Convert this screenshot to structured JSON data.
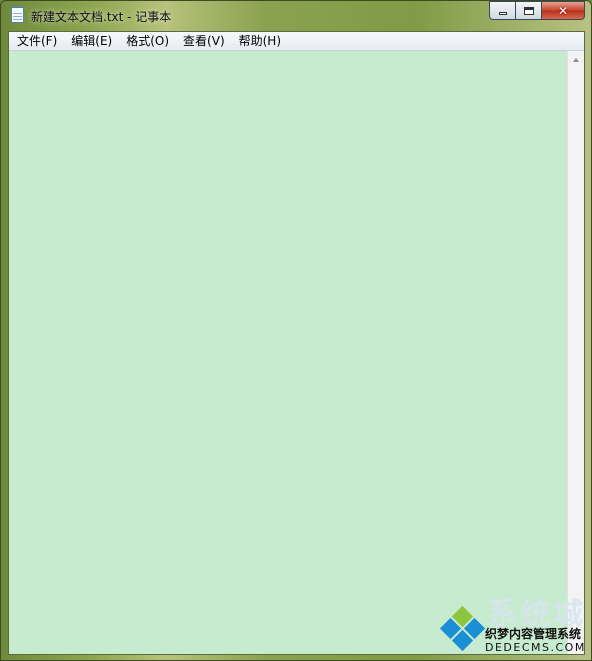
{
  "window": {
    "title": "新建文本文档.txt - 记事本",
    "icon": "notepad-icon",
    "controls": {
      "minimize": "minimize-icon",
      "maximize": "maximize-icon",
      "close": "close-icon"
    }
  },
  "menu": {
    "items": [
      {
        "label": "文件(F)"
      },
      {
        "label": "编辑(E)"
      },
      {
        "label": "格式(O)"
      },
      {
        "label": "查看(V)"
      },
      {
        "label": "帮助(H)"
      }
    ]
  },
  "editor": {
    "content": "",
    "background_color": "#c7ebce"
  },
  "watermark": {
    "text_big": "系统城",
    "text_cn": "织梦内容管理系统",
    "text_en": "DEDECMS.COM"
  }
}
